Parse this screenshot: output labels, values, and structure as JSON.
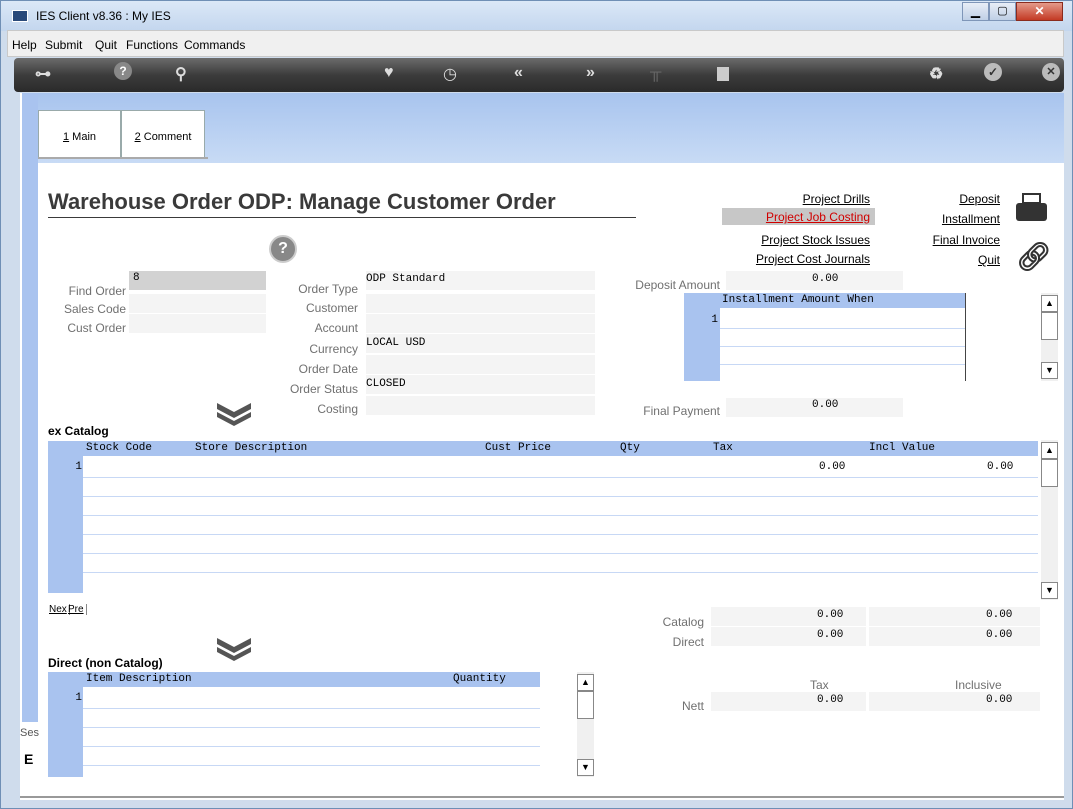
{
  "window": {
    "title": "IES Client v8.36 : My IES"
  },
  "menu": [
    "Help",
    "Submit",
    "Quit",
    "Functions",
    "Commands"
  ],
  "toolbar_icons": [
    "key-icon",
    "help-icon",
    "search-icon",
    "heart-icon",
    "clock-icon",
    "rewind-icon",
    "forward-icon",
    "pin-icon",
    "square-icon",
    "recycle-icon",
    "check-icon",
    "close-icon"
  ],
  "tabs": [
    {
      "num": "1",
      "label": " Main"
    },
    {
      "num": "2",
      "label": " Comment"
    }
  ],
  "page_title": "Warehouse Order ODP: Manage Customer Order",
  "links_left": [
    "Project Drills",
    "Project Job Costing",
    "Project Stock Issues",
    "Project Cost Journals"
  ],
  "links_right": [
    "Deposit",
    "Installment",
    "Final Invoice",
    "Quit"
  ],
  "form_left": {
    "find_order_label": "Find Order",
    "find_order_value": "8",
    "sales_code_label": "Sales Code",
    "cust_order_label": "Cust Order"
  },
  "form_mid": {
    "order_type_label": "Order Type",
    "order_type_value": "ODP Standard",
    "customer_label": "Customer",
    "account_label": "Account",
    "currency_label": "Currency",
    "currency_value": "LOCAL USD",
    "order_date_label": "Order Date",
    "order_status_label": "Order Status",
    "order_status_value": "CLOSED",
    "costing_label": "Costing"
  },
  "deposit": {
    "label": "Deposit Amount",
    "value": "0.00"
  },
  "installment_grid": {
    "header": "Installment Amount When",
    "row_num": "1"
  },
  "final_payment": {
    "label": "Final Payment",
    "value": "0.00"
  },
  "catalog": {
    "section_label": "ex Catalog",
    "columns": [
      "Stock Code",
      "Store Description",
      "Cust Price",
      "Qty",
      "Tax",
      "Incl Value"
    ],
    "row_num": "1",
    "tax_value": "0.00",
    "incl_value": "0.00",
    "nav_next": "Nex",
    "nav_prev": "Pre"
  },
  "totals": {
    "catalog_label": "Catalog",
    "catalog_tax": "0.00",
    "catalog_incl": "0.00",
    "direct_label": "Direct",
    "direct_tax": "0.00",
    "direct_incl": "0.00",
    "tax_header": "Tax",
    "inclusive_header": "Inclusive",
    "nett_label": "Nett",
    "nett_tax": "0.00",
    "nett_incl": "0.00"
  },
  "direct": {
    "section_label": "Direct (non Catalog)",
    "columns": [
      "Item Description",
      "Quantity"
    ],
    "row_num": "1"
  },
  "sidebar_stub": {
    "text": "Ses",
    "icon": "E"
  }
}
